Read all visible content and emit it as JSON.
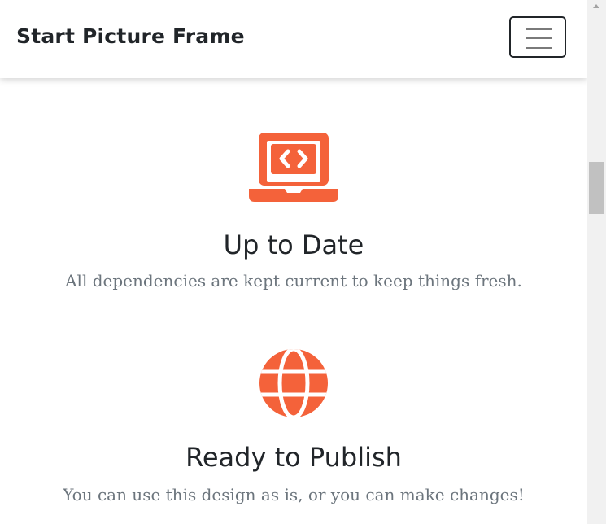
{
  "navbar": {
    "brand": "Start Picture Frame",
    "toggler_icon": "hamburger-menu-icon"
  },
  "features": [
    {
      "icon": "laptop-code-icon",
      "title": "Up to Date",
      "text": "All dependencies are kept current to keep things fresh."
    },
    {
      "icon": "globe-icon",
      "title": "Ready to Publish",
      "text": "You can use this design as is, or you can make changes!"
    }
  ],
  "colors": {
    "accent": "#f4623a",
    "heading": "#212529",
    "muted": "#6c757d"
  }
}
